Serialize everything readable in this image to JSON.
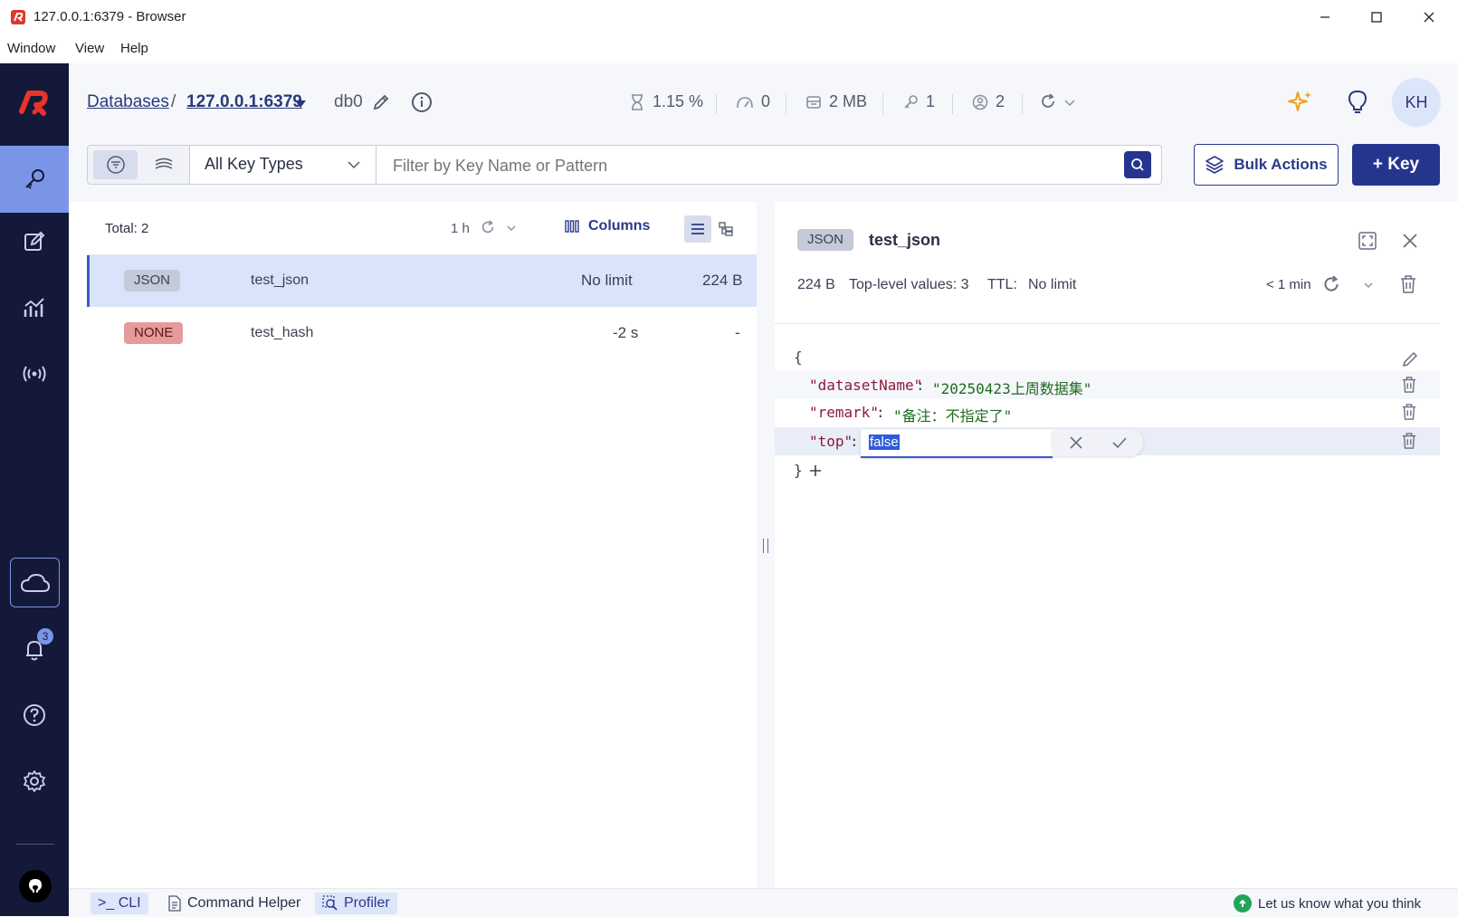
{
  "window": {
    "title": "127.0.0.1:6379 - Browser"
  },
  "menu": [
    "Window",
    "View",
    "Help"
  ],
  "header": {
    "breadcrumb_root": "Databases",
    "breadcrumb_sep": "/",
    "db_address": "127.0.0.1:6379",
    "db_name": "db0",
    "stats": {
      "cpu": "1.15 %",
      "ops": "0",
      "memory": "2 MB",
      "keys": "1",
      "clients": "2"
    },
    "avatar": "KH"
  },
  "toolbar": {
    "key_type_select": "All Key Types",
    "filter_placeholder": "Filter by Key Name or Pattern",
    "bulk_actions": "Bulk Actions",
    "add_key": "+ Key"
  },
  "keylist": {
    "total": "Total: 2",
    "refresh_interval": "1 h",
    "columns_label": "Columns",
    "rows": [
      {
        "type": "JSON",
        "name": "test_json",
        "ttl": "No limit",
        "size": "224 B",
        "selected": true
      },
      {
        "type": "NONE",
        "name": "test_hash",
        "ttl": "-2 s",
        "size": "-",
        "selected": false
      }
    ]
  },
  "details": {
    "type": "JSON",
    "key_name": "test_json",
    "size": "224 B",
    "top_level": "Top-level values: 3",
    "ttl_label": "TTL:",
    "ttl_value": "No limit",
    "last_refresh": "< 1 min",
    "json": {
      "open": "{",
      "close": "}",
      "entries": [
        {
          "key": "\"datasetName\"",
          "value": "\"20250423上周数据集\""
        },
        {
          "key": "\"remark\"",
          "value": "\"备注：不指定了\""
        },
        {
          "key": "\"top\"",
          "edit_value": "false"
        }
      ]
    }
  },
  "bottombar": {
    "cli": ">_ CLI",
    "command_helper": "Command Helper",
    "profiler": "Profiler",
    "feedback": "Let us know what you think"
  },
  "notifications": {
    "count": "3"
  },
  "colors": {
    "nav_bg": "#14193a",
    "nav_active": "#7b95e6",
    "primary": "#25358e",
    "json_badge": "#c5cad8",
    "none_badge": "#e79a9a",
    "selected_row": "#d9e3fa"
  }
}
